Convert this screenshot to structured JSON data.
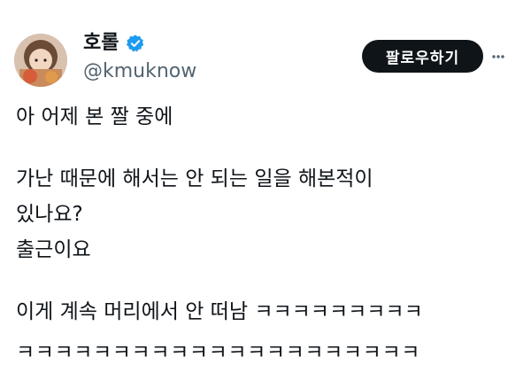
{
  "author": {
    "display_name": "호롤",
    "handle": "@kmuknow",
    "verified_icon": "verified-badge-icon",
    "avatar_icon": "profile-avatar"
  },
  "follow_button": {
    "label": "팔로우하기"
  },
  "more_icon": "more-icon",
  "tweet": {
    "lines": [
      "아 어제 본 짤 중에",
      "가난 때문에 해서는 안 되는 일을 해본적이",
      "있나요?",
      "출근이요",
      "이게 계속 머리에서 안 떠남 ㅋㅋㅋㅋㅋㅋㅋㅋㅋ",
      "ㅋㅋㅋㅋㅋㅋㅋㅋㅋㅋㅋㅋㅋㅋㅋㅋㅋㅋㅋㅋㅋ"
    ]
  },
  "colors": {
    "text": "#0f1419",
    "secondary_text": "#536471",
    "verified_blue": "#1d9bf0",
    "button_bg": "#0f1419",
    "button_text": "#ffffff"
  }
}
